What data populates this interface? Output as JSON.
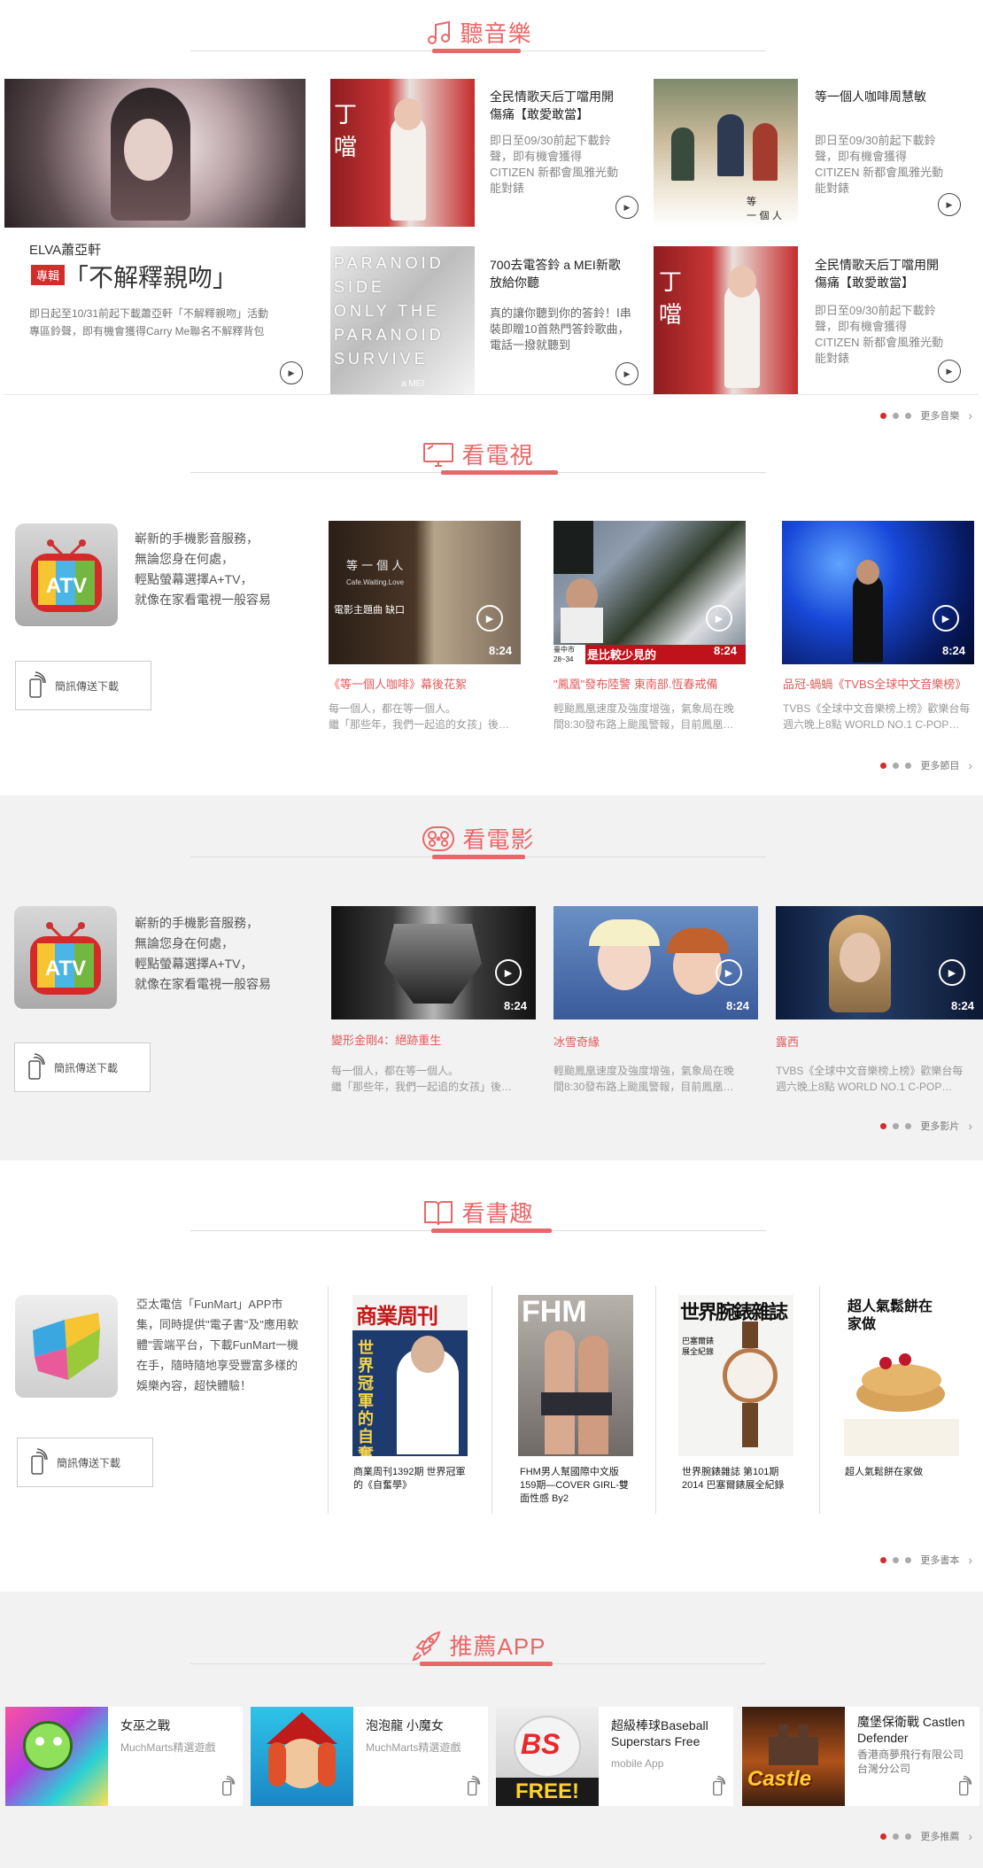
{
  "music": {
    "title": "聽音樂",
    "feature": {
      "artist": "ELVA蕭亞軒",
      "badge": "專輯",
      "album": "「不解釋親吻」",
      "desc": "即日起至10/31前起下載蕭亞軒「不解釋親吻」活動專區鈴聲，即有機會獲得Carry Me聯名不解釋背包"
    },
    "cards": [
      {
        "title": "全民情歌天后丁噹用開傷痛【敢愛敢當】",
        "desc": "即日至09/30前起下載鈴聲，即有機會獲得CITIZEN 新都會風雅光動能對錶"
      },
      {
        "title": "等一個人咖啡周慧敏",
        "desc": "即日至09/30前起下載鈴聲，即有機會獲得CITIZEN 新都會風雅光動能對錶"
      },
      {
        "title": "700去電答鈴 a MEI新歌放給你聽",
        "desc": "真的讓你聽到你的答鈴！Ⅰ串裝即贈10首熱門答鈴歌曲，電話一撥就聽到"
      },
      {
        "title": "全民情歌天后丁噹用開傷痛【敢愛敢當】",
        "desc": "即日至09/30前起下載鈴聲，即有機會獲得CITIZEN 新都會風雅光動能對錶"
      }
    ],
    "more": "更多音樂"
  },
  "tv": {
    "title": "看電視",
    "promo": [
      "嶄新的手機影音服務，",
      "無論您身在何處，",
      "輕點螢幕選擇A+TV，",
      "就像在家看電視一般容易"
    ],
    "download": "簡訊傳送下載",
    "logo_text": "ATV",
    "videos": [
      {
        "title": "《等一個人咖啡》幕後花絮",
        "desc": "每一個人，都在等一個人。",
        "desc2": "繼「那些年，我們一起追的女孩」後…",
        "duration": "8:24",
        "overlay1": "等 一 個 人",
        "overlay2": "Cafe.Waiting.Love",
        "overlay3": "電影主題曲  缺口"
      },
      {
        "title": "\"鳳凰\"發布陸警 東南部.恆春戒備",
        "desc": "輕颱鳳凰速度及強度增強，氣象局在晚",
        "desc2": "間8:30發布路上颱風警報，目前鳳凰…",
        "duration": "8:24",
        "overlay1": "是比較少見的",
        "overlay2": "臺中市 28~34"
      },
      {
        "title": "品冠-蝸蝸《TVBS全球中文音樂榜》",
        "desc": "TVBS《全球中文音樂榜上榜》歡樂台每",
        "desc2": "週六晚上8點 WORLD NO.1 C-POP…",
        "duration": "8:24"
      }
    ],
    "more": "更多節目"
  },
  "movie": {
    "title": "看電影",
    "promo": [
      "嶄新的手機影音服務，",
      "無論您身在何處，",
      "輕點螢幕選擇A+TV，",
      "就像在家看電視一般容易"
    ],
    "download": "簡訊傳送下載",
    "logo_text": "ATV",
    "videos": [
      {
        "title": "變形金剛4：絕跡重生",
        "desc": "每一個人，都在等一個人。",
        "desc2": "繼「那些年，我們一起追的女孩」後…",
        "duration": "8:24"
      },
      {
        "title": "冰雪奇緣",
        "desc": "輕颱鳳凰速度及強度增強，氣象局在晚",
        "desc2": "間8:30發布路上颱風警報，目前鳳凰…",
        "duration": "8:24"
      },
      {
        "title": "露西",
        "desc": "TVBS《全球中文音樂榜上榜》歡樂台每",
        "desc2": "週六晚上8點 WORLD NO.1 C-POP…",
        "duration": "8:24"
      }
    ],
    "more": "更多影片"
  },
  "books": {
    "title": "看書趣",
    "promo": "亞太電信「FunMart」APP市集，同時提供\"電子書\"及\"應用軟體\"雲端平台，下載FunMart一機在手，隨時隨地享受豐富多樣的娛樂內容，超快體驗！",
    "download": "簡訊傳送下載",
    "items": [
      {
        "title": "商業周刊1392期 世界冠軍的《自奮學》",
        "cover_head": "商業周刊",
        "cover_sub": "世界冠軍的自奮學"
      },
      {
        "title": "FHM男人幫國際中文版159期—COVER GIRL-雙面性感 By2",
        "cover_head": "FHM"
      },
      {
        "title": "世界腕錶雜誌 第101期 2014 巴塞爾錶展全紀錄",
        "cover_head": "世界腕錶雜誌",
        "cover_sub": "巴塞爾錶展全紀錄"
      },
      {
        "title": "超人氣鬆餅在家做",
        "cover_head": "超人氣鬆餅在家做"
      }
    ],
    "more": "更多書本"
  },
  "apps": {
    "title": "推薦APP",
    "items": [
      {
        "name": "女巫之戰",
        "sub": "MuchMarts精選遊戲"
      },
      {
        "name": "泡泡龍 小魔女",
        "sub": "MuchMarts精選遊戲"
      },
      {
        "name": "超級棒球Baseball Superstars Free",
        "sub": "mobile App",
        "icon_text": "BS",
        "icon_text2": "FREE!"
      },
      {
        "name": "魔堡保衛戰 Castlen Defender",
        "sub": "香港商夢飛行有限公司台灣分公司",
        "icon_text": "Castle"
      }
    ],
    "more": "更多推薦"
  },
  "colors": {
    "accent": "#e8686a",
    "dot_active": "#d42b2b",
    "badge": "#d42b2b"
  }
}
